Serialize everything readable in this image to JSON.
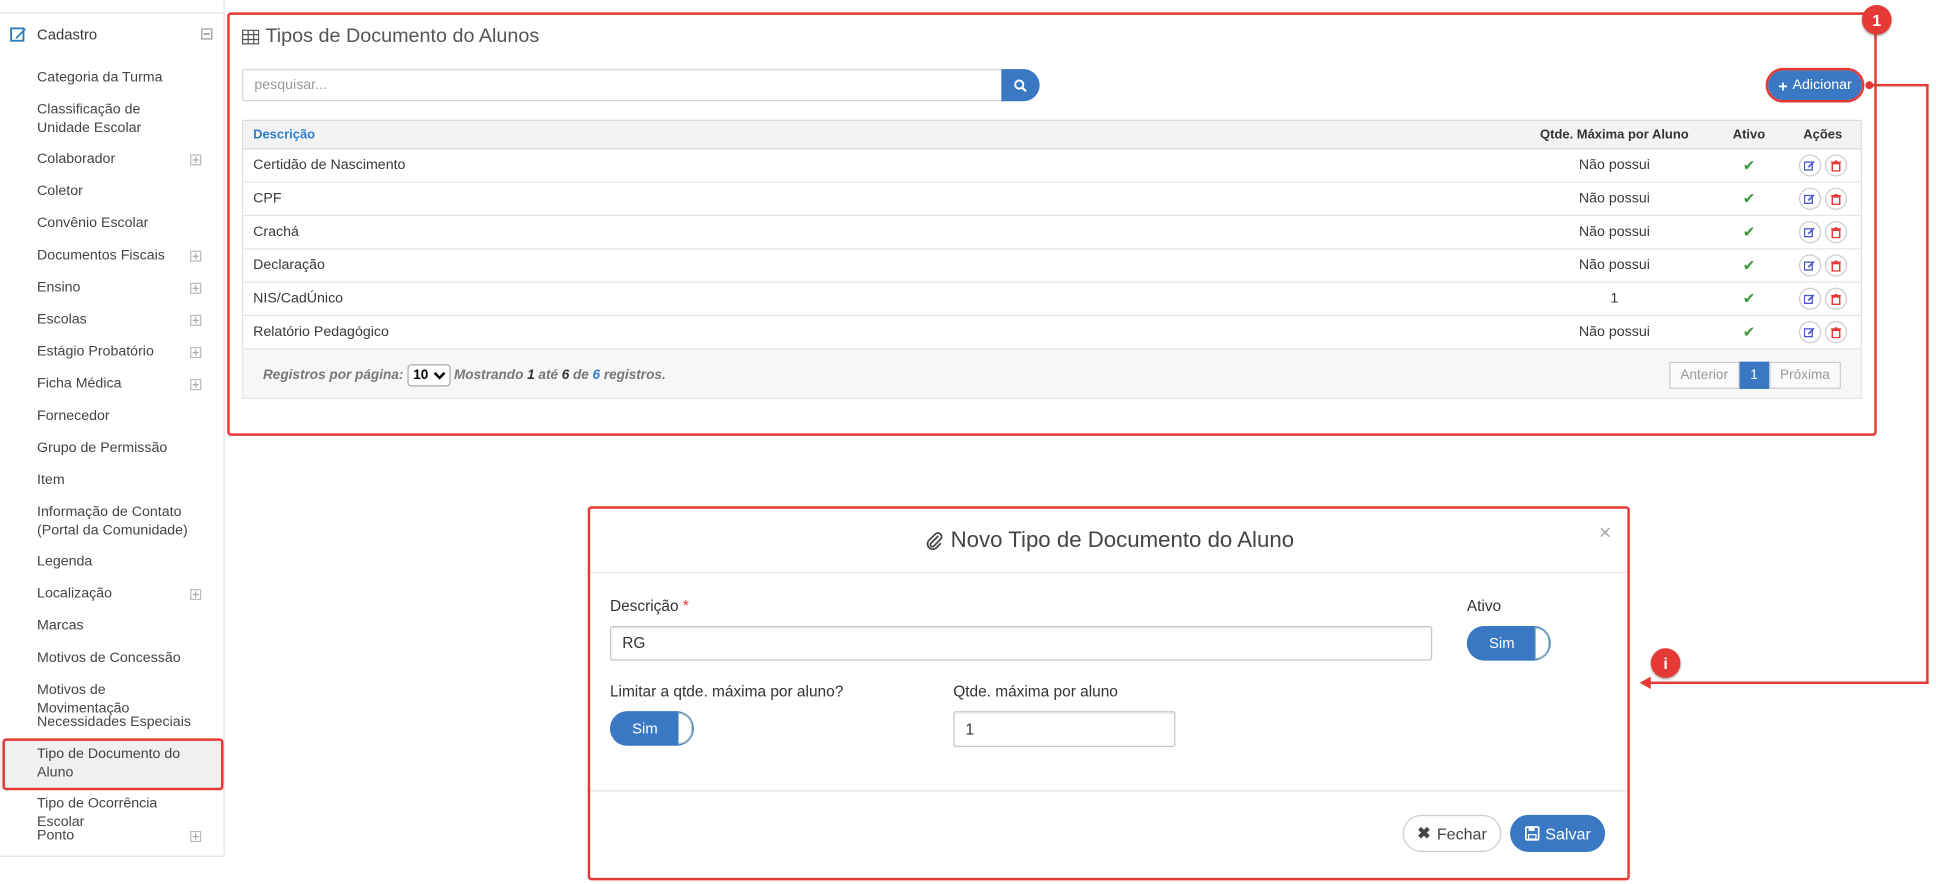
{
  "sidebar": {
    "header": "Cadastro",
    "items": [
      {
        "label": "Categoria da Turma",
        "expand": false
      },
      {
        "label": "Classificação de Unidade Escolar",
        "expand": false
      },
      {
        "label": "Colaborador",
        "expand": true
      },
      {
        "label": "Coletor",
        "expand": false
      },
      {
        "label": "Convênio Escolar",
        "expand": false
      },
      {
        "label": "Documentos Fiscais",
        "expand": true
      },
      {
        "label": "Ensino",
        "expand": true
      },
      {
        "label": "Escolas",
        "expand": true
      },
      {
        "label": "Estágio Probatório",
        "expand": true
      },
      {
        "label": "Ficha Médica",
        "expand": true
      },
      {
        "label": "Fornecedor",
        "expand": false
      },
      {
        "label": "Grupo de Permissão",
        "expand": false
      },
      {
        "label": "Item",
        "expand": false
      },
      {
        "label": "Informação de Contato (Portal da Comunidade)",
        "expand": false
      },
      {
        "label": "Legenda",
        "expand": false
      },
      {
        "label": "Localização",
        "expand": true
      },
      {
        "label": "Marcas",
        "expand": false
      },
      {
        "label": "Motivos de Concessão",
        "expand": false
      },
      {
        "label": "Motivos de Movimentação",
        "expand": false
      },
      {
        "label": "Necessidades Especiais",
        "expand": false
      },
      {
        "label": "Tipo de Documento do Aluno",
        "expand": false
      },
      {
        "label": "Tipo de Ocorrência Escolar",
        "expand": false
      },
      {
        "label": "Ponto",
        "expand": true
      }
    ]
  },
  "panel": {
    "title": "Tipos de Documento do Alunos",
    "search_placeholder": "pesquisar...",
    "add_label": "Adicionar",
    "columns": {
      "descricao": "Descrição",
      "qtde": "Qtde. Máxima por Aluno",
      "ativo": "Ativo",
      "acoes": "Ações"
    },
    "rows": [
      {
        "descricao": "Certidão de Nascimento",
        "qtde": "Não possui"
      },
      {
        "descricao": "CPF",
        "qtde": "Não possui"
      },
      {
        "descricao": "Crachá",
        "qtde": "Não possui"
      },
      {
        "descricao": "Declaração",
        "qtde": "Não possui"
      },
      {
        "descricao": "NIS/CadÚnico",
        "qtde": "1"
      },
      {
        "descricao": "Relatório Pedagógico",
        "qtde": "Não possui"
      }
    ],
    "footer": {
      "per_page_label": "Registros por página:",
      "per_page_value": "10",
      "showing": "Mostrando",
      "from": "1",
      "ate": "até",
      "to": "6",
      "de": "de",
      "total": "6",
      "registros": "registros."
    },
    "pager": {
      "prev": "Anterior",
      "page": "1",
      "next": "Próxima"
    }
  },
  "modal": {
    "title": "Novo Tipo de Documento do Aluno",
    "close": "×",
    "descricao_label": "Descrição",
    "required_mark": "*",
    "descricao_value": "RG",
    "ativo_label": "Ativo",
    "ativo_value": "Sim",
    "limitar_label": "Limitar a qtde. máxima por aluno?",
    "limitar_value": "Sim",
    "qtde_label": "Qtde. máxima por aluno",
    "qtde_value": "1",
    "fechar": "Fechar",
    "salvar": "Salvar"
  },
  "annotations": {
    "badge1": "1",
    "badge2": "i"
  },
  "colors": {
    "primary": "#3a78c3",
    "annotation": "#e53935",
    "check": "#3a9a3a"
  }
}
